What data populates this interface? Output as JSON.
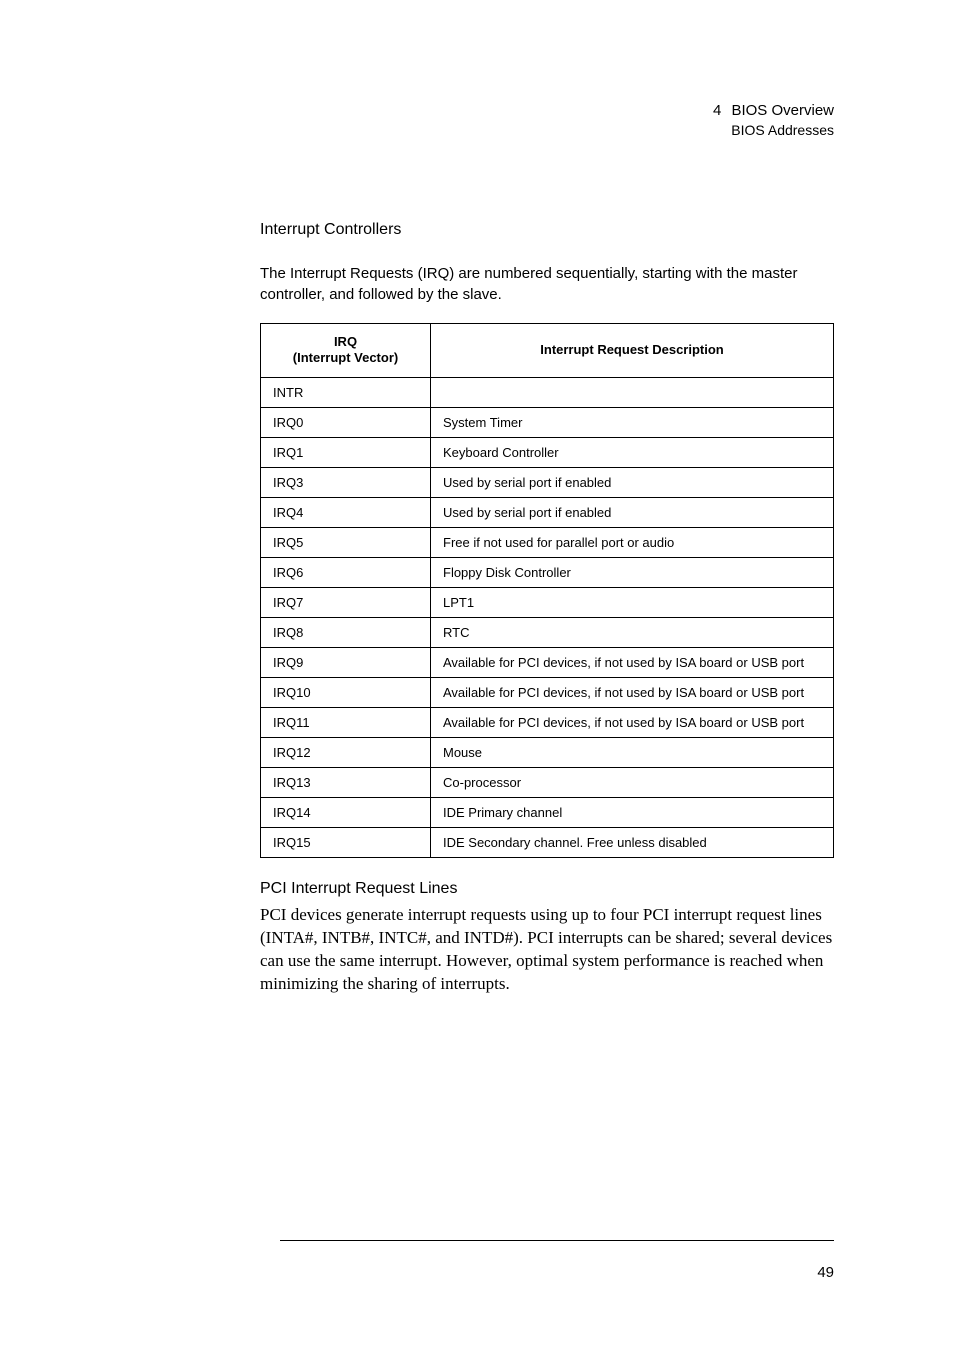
{
  "header": {
    "chapter_num": "4",
    "chapter_title": "BIOS Overview",
    "section": "BIOS Addresses"
  },
  "section1": {
    "heading": "Interrupt Controllers",
    "intro": "The Interrupt Requests (IRQ) are numbered sequentially, starting with the master controller, and followed by the slave."
  },
  "table": {
    "col1_line1": "IRQ",
    "col1_line2": "(Interrupt Vector)",
    "col2": "Interrupt Request Description",
    "rows": [
      {
        "irq": "INTR",
        "desc": ""
      },
      {
        "irq": "IRQ0",
        "desc": "System Timer"
      },
      {
        "irq": "IRQ1",
        "desc": "Keyboard Controller"
      },
      {
        "irq": "IRQ3",
        "desc": "Used by serial port if enabled"
      },
      {
        "irq": "IRQ4",
        "desc": "Used by serial port if enabled"
      },
      {
        "irq": "IRQ5",
        "desc": "Free if not used for parallel port or audio"
      },
      {
        "irq": "IRQ6",
        "desc": "Floppy Disk Controller"
      },
      {
        "irq": "IRQ7",
        "desc": "LPT1"
      },
      {
        "irq": "IRQ8",
        "desc": "RTC"
      },
      {
        "irq": "IRQ9",
        "desc": "Available for PCI devices, if not used by ISA board or USB port"
      },
      {
        "irq": "IRQ10",
        "desc": "Available for PCI devices, if not used by ISA board or USB port"
      },
      {
        "irq": "IRQ11",
        "desc": "Available for PCI devices, if not used by ISA board or USB port"
      },
      {
        "irq": "IRQ12",
        "desc": "Mouse"
      },
      {
        "irq": "IRQ13",
        "desc": "Co-processor"
      },
      {
        "irq": "IRQ14",
        "desc": "IDE Primary channel"
      },
      {
        "irq": "IRQ15",
        "desc": "IDE Secondary channel. Free unless disabled"
      }
    ]
  },
  "section2": {
    "heading": "PCI Interrupt Request Lines",
    "body": "PCI devices generate interrupt requests using up to four PCI interrupt request lines (INTA#, INTB#, INTC#, and INTD#). PCI interrupts can be shared; several devices can use the same interrupt. However, optimal system performance is reached when minimizing the sharing of interrupts."
  },
  "page_number": "49"
}
